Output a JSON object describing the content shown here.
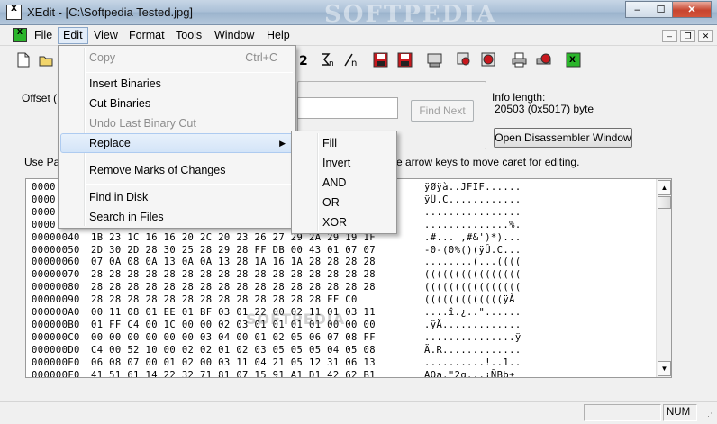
{
  "window": {
    "app_icon_text": "X",
    "title": "XEdit - [C:\\Softpedia Tested.jpg]",
    "watermark": "SOFTPEDIA",
    "minimize": "‒",
    "maximize": "☐",
    "close": "✕"
  },
  "menubar": {
    "items": [
      "File",
      "Edit",
      "View",
      "Format",
      "Tools",
      "Window",
      "Help"
    ],
    "mdi": [
      "‒",
      "❐",
      "✕"
    ]
  },
  "toolbar": {
    "icons": [
      "new-file-icon",
      "open-folder-icon",
      "sum-2-icon",
      "sum-n-icon",
      "fraction-n-icon",
      "save-red-icon",
      "save-red-alt-icon",
      "disk-drive-icon",
      "find-red-icon",
      "search-red-icon",
      "print-icon",
      "print-red-icon",
      "xedit-app-icon"
    ]
  },
  "panel": {
    "offset_label": "Offset (H",
    "find_next_button": "Find Next",
    "info_length_label": "Info length:",
    "info_length_value": "20503 (0x5017) byte",
    "disassembler_button": "Open Disassembler Window",
    "use_label_left": "Use Pa",
    "use_label_right": "e arrow keys to move caret for editing."
  },
  "hex": {
    "rows": [
      {
        "offset": "0000",
        "bytes": "",
        "ascii": "ÿØÿà..JFIF......"
      },
      {
        "offset": "0000",
        "bytes": "",
        "ascii": "ÿÛ.C............"
      },
      {
        "offset": "0000",
        "bytes": "",
        "ascii": "................"
      },
      {
        "offset": "0000",
        "bytes": "",
        "ascii": "..............%."
      },
      {
        "offset": "00000040",
        "bytes": "1B 23 1C 16 16 20 2C 20 23 26 27 29 2A 29 19 1F",
        "ascii": ".#... ,#&')*)..."
      },
      {
        "offset": "00000050",
        "bytes": "2D 30 2D 28 30 25 28 29 28 FF DB 00 43 01 07 07",
        "ascii": "-0-(0%()(ÿÛ.C..."
      },
      {
        "offset": "00000060",
        "bytes": "07 0A 08 0A 13 0A 0A 13 28 1A 16 1A 28 28 28 28",
        "ascii": "........(...(((("
      },
      {
        "offset": "00000070",
        "bytes": "28 28 28 28 28 28 28 28 28 28 28 28 28 28 28 28",
        "ascii": "(((((((((((((((("
      },
      {
        "offset": "00000080",
        "bytes": "28 28 28 28 28 28 28 28 28 28 28 28 28 28 28 28",
        "ascii": "(((((((((((((((("
      },
      {
        "offset": "00000090",
        "bytes": "28 28 28 28 28 28 28 28 28 28 28 28 28 FF C0",
        "ascii": "(((((((((((((ÿÀ"
      },
      {
        "offset": "000000A0",
        "bytes": "00 11 08 01 EE 01 BF 03 01 22 00 02 11 01 03 11",
        "ascii": "....î.¿..\"......"
      },
      {
        "offset": "000000B0",
        "bytes": "01 FF C4 00 1C 00 00 02 03 01 01 01 01 00 00 00",
        "ascii": ".ÿÄ............."
      },
      {
        "offset": "000000C0",
        "bytes": "00 00 00 00 00 00 03 04 00 01 02 05 06 07 08 FF",
        "ascii": "...............ÿ"
      },
      {
        "offset": "000000D0",
        "bytes": "C4 00 52 10 00 02 02 01 02 03 05 05 05 04 05 08",
        "ascii": "Ä.R............."
      },
      {
        "offset": "000000E0",
        "bytes": "06 08 07 00 01 02 00 03 11 04 21 05 12 31 06 13",
        "ascii": "..........!..1.."
      },
      {
        "offset": "000000F0",
        "bytes": "41 51 61 14 22 32 71 81 07 15 91 A1 D1 42 62 B1",
        "ascii": "AQa.\"2q...¡ÑBb±"
      }
    ]
  },
  "edit_menu": {
    "items": [
      {
        "label": "Copy",
        "shortcut": "Ctrl+C",
        "disabled": true
      },
      {
        "label": "Insert Binaries"
      },
      {
        "label": "Cut Binaries"
      },
      {
        "label": "Undo Last Binary Cut",
        "disabled": true
      },
      {
        "label": "Replace",
        "submenu": true
      },
      {
        "label": "Remove Marks of Changes"
      },
      {
        "label": "Find in Disk"
      },
      {
        "label": "Search in Files"
      }
    ]
  },
  "replace_submenu": {
    "items": [
      "Fill",
      "Invert",
      "AND",
      "OR",
      "XOR"
    ]
  },
  "statusbar": {
    "num": "NUM"
  },
  "hex_watermark": "SOFTPEDIA"
}
